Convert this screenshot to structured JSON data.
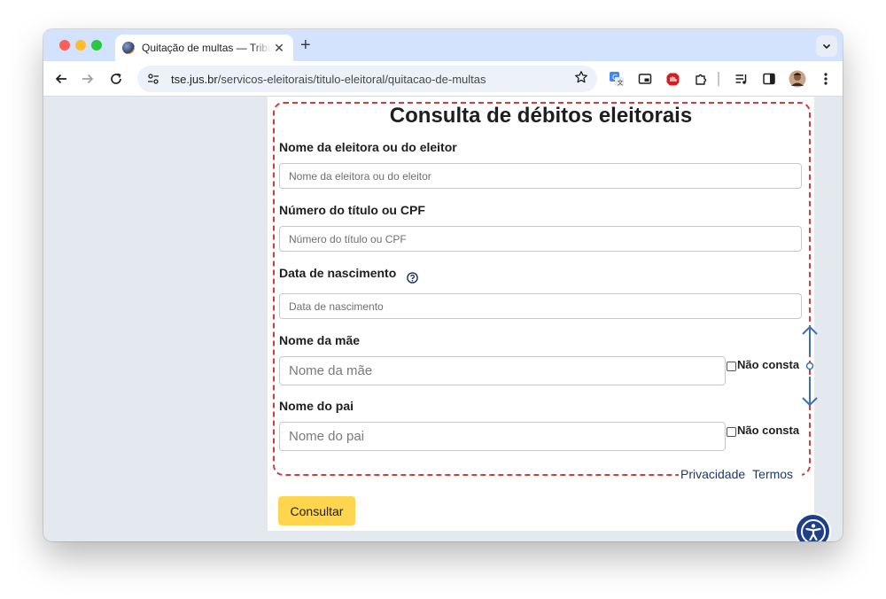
{
  "browser": {
    "tab_title": "Quitação de multas — Tribunal Superior Eleitoral",
    "url_domain": "tse.jus.br",
    "url_path": "/servicos-eleitorais/titulo-eleitoral/quitacao-de-multas",
    "newtab_symbol": "+",
    "tab_close_symbol": "✕"
  },
  "form": {
    "title": "Consulta de débitos eleitorais",
    "fields": [
      {
        "label": "Nome da eleitora ou do eleitor",
        "placeholder": "Nome da eleitora ou do eleitor",
        "value": ""
      },
      {
        "label": "Número do título ou CPF",
        "placeholder": "Número do título ou CPF",
        "value": ""
      },
      {
        "label": "Data de nascimento",
        "placeholder": "Data de nascimento",
        "value": ""
      },
      {
        "label": "Nome da mãe",
        "placeholder": "Nome da mãe",
        "value": "",
        "checkbox_label": "Não consta",
        "checked": false
      },
      {
        "label": "Nome do pai",
        "placeholder": "Nome do pai",
        "value": "",
        "checkbox_label": "Não consta",
        "checked": false
      }
    ],
    "submit_label": "Consultar"
  },
  "footer": {
    "privacy": "Privacidade",
    "terms": "Termos"
  },
  "colors": {
    "accent_yellow": "#ffd54f",
    "dashed_red": "#d83a3a",
    "link_blue": "#1b3a6b",
    "a11y_blue": "#1e3f8a",
    "tabbar": "#d3e3fd"
  },
  "icons": [
    "globe-favicon-icon",
    "close-icon",
    "plus-icon",
    "chevron-down-icon",
    "back-arrow-icon",
    "forward-arrow-icon",
    "reload-icon",
    "site-settings-icon",
    "star-icon",
    "translate-icon",
    "picture-in-picture-icon",
    "shield-extension-icon",
    "puzzle-extension-icon",
    "reading-list-icon",
    "side-panel-icon",
    "profile-avatar-icon",
    "kebab-menu-icon",
    "help-circle-icon",
    "resize-handle-icon",
    "accessibility-icon"
  ]
}
